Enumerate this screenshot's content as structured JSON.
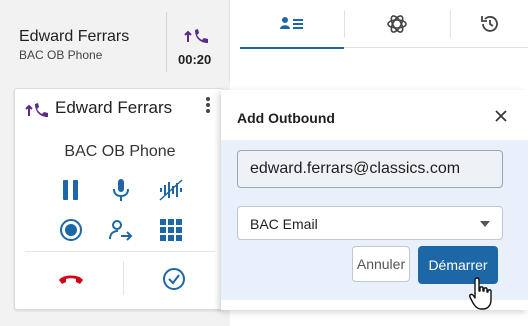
{
  "call_header": {
    "contact_name": "Edward Ferrars",
    "queue": "BAC OB Phone",
    "timer": "00:20",
    "icon": "outbound-call-icon"
  },
  "call_card": {
    "contact_name": "Edward Ferrars",
    "queue": "BAC OB Phone",
    "icons": {
      "direction": "outbound-call-icon",
      "more": "more-vertical-icon",
      "hold": "pause-icon",
      "mute": "microphone-icon",
      "noise": "audio-wave-icon",
      "record": "record-icon",
      "transfer": "transfer-user-icon",
      "dialpad": "dialpad-icon",
      "hangup": "hang-up-icon",
      "complete": "check-circle-icon"
    }
  },
  "tabs": [
    {
      "name": "contacts-tab",
      "icon": "contact-list-icon",
      "active": true
    },
    {
      "name": "ai-tab",
      "icon": "openai-icon",
      "active": false
    },
    {
      "name": "history-tab",
      "icon": "history-icon",
      "active": false
    }
  ],
  "dialog": {
    "title": "Add Outbound",
    "email_value": "edward.ferrars@classics.com",
    "channel_selected": "BAC Email",
    "cancel_label": "Annuler",
    "start_label": "Démarrer"
  },
  "colors": {
    "accent": "#1d67a6",
    "purple": "#5b2a86",
    "red": "#d0021b",
    "dialog_body_bg": "#e8f1fb",
    "panel_bg": "#f2f2f2"
  }
}
